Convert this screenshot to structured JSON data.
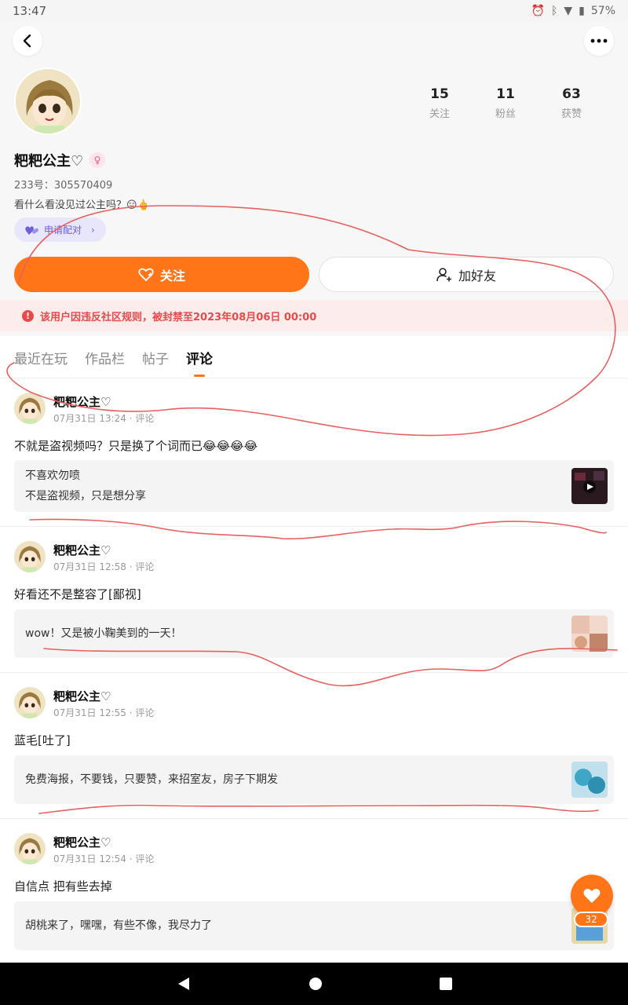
{
  "status_bar": {
    "time": "13:47",
    "battery": "57%"
  },
  "profile": {
    "name": "粑粑公主♡",
    "uid": "233号：305570409",
    "bio": "看什么看没见过公主吗？😑🖕",
    "pair_label": "申请配对",
    "stats": [
      {
        "num": "15",
        "label": "关注"
      },
      {
        "num": "11",
        "label": "粉丝"
      },
      {
        "num": "63",
        "label": "获赞"
      }
    ],
    "follow_label": "关注",
    "add_friend_label": "加好友",
    "ban_notice": "该用户因违反社区规则，被封禁至2023年08月06日 00:00"
  },
  "tabs": [
    "最近在玩",
    "作品栏",
    "帖子",
    "评论"
  ],
  "active_tab": "评论",
  "posts": [
    {
      "name": "粑粑公主♡",
      "meta": "07月31日 13:24 · 评论",
      "text": "不就是盗视频吗？只是换了个词而已😂😂😂😂",
      "quote": [
        "不喜欢勿喷",
        "不是盗视频，只是想分享"
      ]
    },
    {
      "name": "粑粑公主♡",
      "meta": "07月31日 12:58 · 评论",
      "text": "好看还不是整容了[鄙视]",
      "quote": [
        "wow！又是被小鞠美到的一天！"
      ]
    },
    {
      "name": "粑粑公主♡",
      "meta": "07月31日 12:55 · 评论",
      "text": "蓝毛[吐了]",
      "quote": [
        "免费海报，不要钱，只要赞，来招室友，房子下期发"
      ]
    },
    {
      "name": "粑粑公主♡",
      "meta": "07月31日 12:54 · 评论",
      "text": "自信点 把有些去掉",
      "quote": [
        "胡桃来了，嘿嘿，有些不像，我尽力了"
      ]
    }
  ],
  "fab_count": "32",
  "colors": {
    "accent": "#ff7518",
    "ban_text": "#e84a4a",
    "ban_bg": "#fdecec",
    "annotation": "#e86060"
  }
}
